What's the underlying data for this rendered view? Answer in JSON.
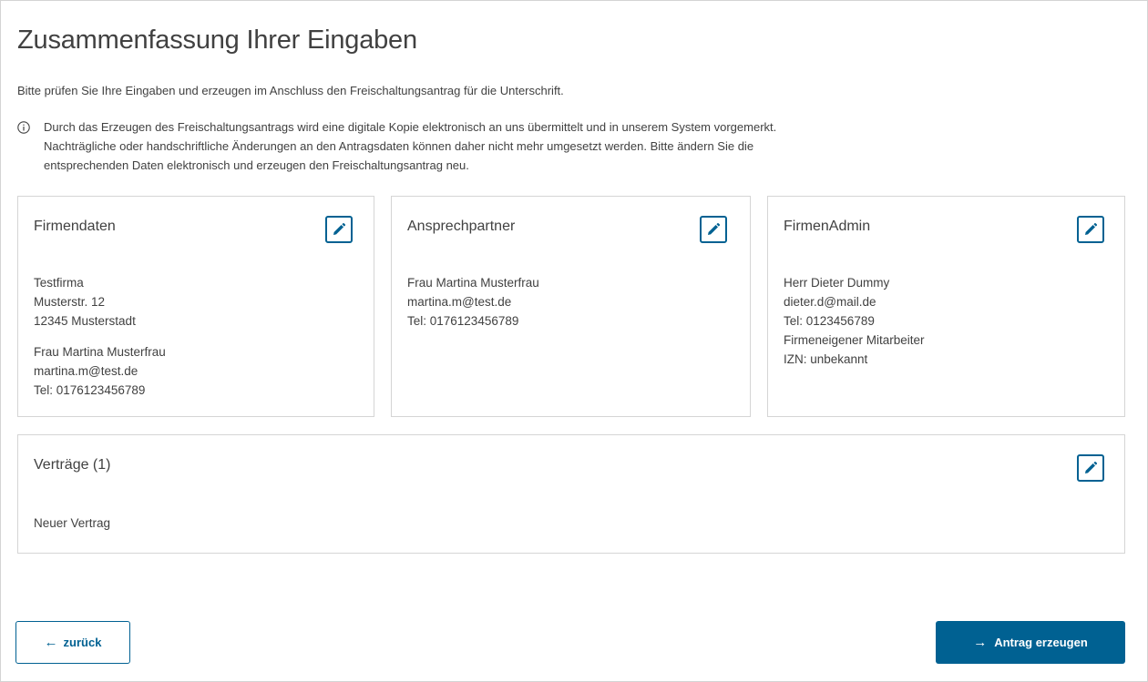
{
  "page": {
    "title": "Zusammenfassung Ihrer Eingaben",
    "intro": "Bitte prüfen Sie Ihre Eingaben und erzeugen im Anschluss den Freischaltungsantrag für die Unterschrift.",
    "notice": {
      "icon": "info-icon",
      "lines": [
        "Durch das Erzeugen des Freischaltungsantrags wird eine digitale Kopie elektronisch an uns übermittelt und in unserem System vorgemerkt.",
        "Nachträgliche oder handschriftliche Änderungen an den Antragsdaten können daher nicht mehr umgesetzt werden. Bitte ändern Sie die",
        "entsprechenden Daten elektronisch und erzeugen den Freischaltungsantrag neu."
      ]
    }
  },
  "cards": {
    "firmendaten": {
      "title": "Firmendaten",
      "edit_icon": "pencil-icon",
      "address": [
        "Testfirma",
        "Musterstr. 12",
        "12345 Musterstadt"
      ],
      "contact": [
        "Frau Martina Musterfrau",
        "martina.m@test.de",
        "Tel: 0176123456789"
      ]
    },
    "ansprechpartner": {
      "title": "Ansprechpartner",
      "edit_icon": "pencil-icon",
      "contact": [
        "Frau Martina Musterfrau",
        "martina.m@test.de",
        "Tel: 0176123456789"
      ]
    },
    "firmenadmin": {
      "title": "FirmenAdmin",
      "edit_icon": "pencil-icon",
      "contact": [
        "Herr Dieter Dummy",
        "dieter.d@mail.de",
        "Tel: 0123456789",
        "Firmeneigener Mitarbeiter",
        "IZN: unbekannt"
      ]
    },
    "vertraege": {
      "title": "Verträge (1)",
      "edit_icon": "pencil-icon",
      "items": [
        "Neuer Vertrag"
      ]
    }
  },
  "actions": {
    "back_label": "zurück",
    "back_icon": "arrow-left-icon",
    "submit_label": "Antrag erzeugen",
    "submit_icon": "arrow-right-icon"
  },
  "colors": {
    "primary": "#006192",
    "text": "#414141",
    "border": "#d5d5d5"
  }
}
